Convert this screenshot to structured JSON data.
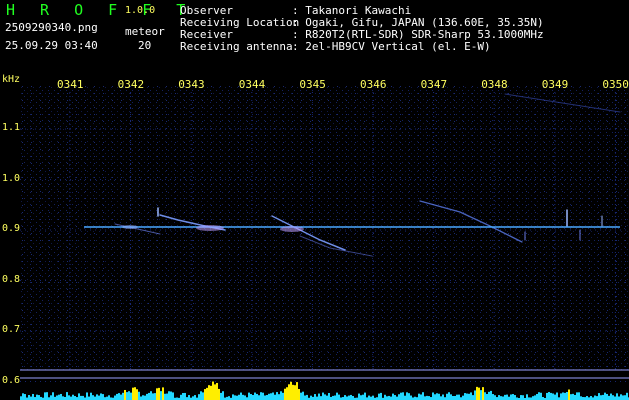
{
  "app": {
    "name": "H R O F F T",
    "version": "1.0.0"
  },
  "file": {
    "name": "2509290340.png",
    "datetime": "25.09.29 03:40"
  },
  "meteor": {
    "label": "meteor",
    "count": "20"
  },
  "info": {
    "observer_label": "Observer",
    "observer_value": ": Takanori Kawachi",
    "location_label": "Receiving Location",
    "location_value": ": Ogaki, Gifu, JAPAN (136.60E, 35.35N)",
    "receiver_label": "Receiver",
    "receiver_value": ": R820T2(RTL-SDR) SDR-Sharp 53.1000MHz",
    "antenna_label": "Receiving antenna",
    "antenna_value": ": 2el-HB9CV Vertical (el. E-W)"
  },
  "axis": {
    "unit": "kHz",
    "times": [
      "0341",
      "0342",
      "0343",
      "0344",
      "0345",
      "0346",
      "0347",
      "0348",
      "0349",
      "0350"
    ],
    "freqs": [
      "1.1",
      "1.0",
      "0.9",
      "0.8",
      "0.7",
      "0.6"
    ]
  },
  "colors": {
    "background": "#000000",
    "grid": "#1c2a7a",
    "carrier": "#4aa8ff",
    "activity_low": "#22d8ff",
    "activity_high": "#ffee00",
    "title": "#20ff20",
    "label": "#ffff60"
  }
}
